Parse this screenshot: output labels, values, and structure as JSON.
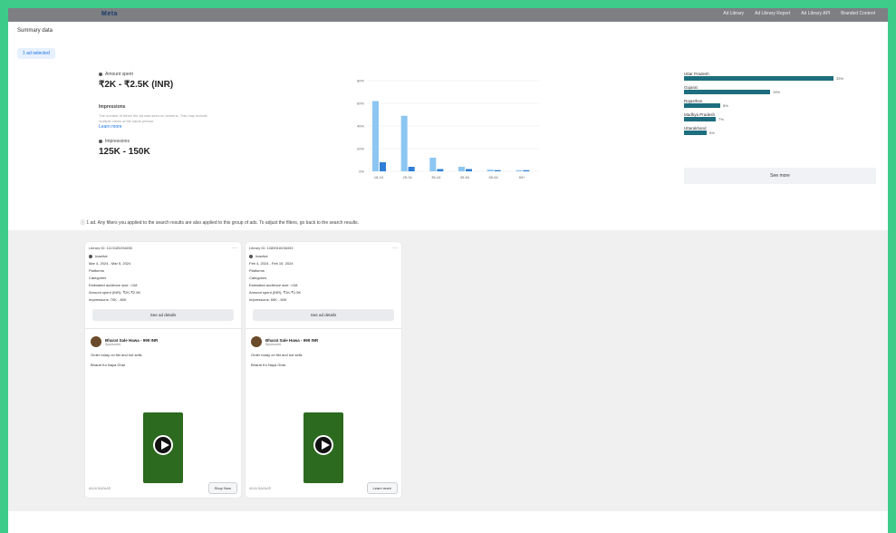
{
  "header": {
    "logo": "Meta",
    "nav": [
      "Ad Library",
      "Ad Library Report",
      "Ad Library API",
      "Branded Content"
    ]
  },
  "page_title": "Summary data",
  "select_button": "1 ad selected",
  "summary": {
    "amount_spent_label": "Amount spent",
    "amount_spent_value": "₹2K - ₹2.5K (INR)",
    "impressions_heading": "Impressions",
    "impressions_desc": "The number of times the ad was seen on screens. This may include multiple views of the same person.",
    "learn_more": "Learn more",
    "impressions_label": "Impressions",
    "impressions_value": "125K - 150K"
  },
  "age_chart": {
    "categories": [
      "18-24",
      "25-34",
      "35-44",
      "45-54",
      "55-64",
      "65+"
    ],
    "series": [
      {
        "values": [
          62,
          49,
          12,
          4,
          1.5,
          1
        ],
        "color": "#8cc6f2"
      },
      {
        "values": [
          8,
          4,
          2,
          2,
          1,
          1
        ],
        "color": "#2f7fd6"
      }
    ],
    "yticks": [
      "0%",
      "20%",
      "40%",
      "60%",
      "80%"
    ],
    "y_max": 80
  },
  "regions": {
    "items": [
      {
        "label": "Uttar Pradesh",
        "pct": "33%",
        "value": 33
      },
      {
        "label": "Gujarat",
        "pct": "19%",
        "value": 19
      },
      {
        "label": "Rajasthan",
        "pct": "8%",
        "value": 8
      },
      {
        "label": "Madhya Pradesh",
        "pct": "7%",
        "value": 7
      },
      {
        "label": "Uttarakhand",
        "pct": "5%",
        "value": 5
      }
    ],
    "see_more": "See more"
  },
  "notice": "ⓘ 1 ad. Any filters you applied to the search results are also applied to this group of ads. To adjust the filters, go back to the search results.",
  "ads": [
    {
      "library_id": "Library ID: 1113185294655",
      "status": "Inactive",
      "dates": "Mar 4, 2024 - Mar 5, 2024",
      "platforms": "Platforms",
      "categories": "Categories",
      "audience": "Estimated audience size: >1M",
      "spend": "Amount spent (INR): ₹2K-₹2.5K",
      "impressions": "Impressions: 70K - 80K",
      "details_btn": "See ad details",
      "brand": "Bharat Sale Hawa - 999 INR",
      "brand_sub": "Sponsored",
      "ad_line1": "Order today on fist and hot sells",
      "ad_line2": "Bharat Ko Naya Ghar",
      "footer_text": "ANJU BAZAAR",
      "cta": "Shop Now"
    },
    {
      "library_id": "Library ID: 1085918438493",
      "status": "Inactive",
      "dates": "Feb 4, 2024 - Feb 15, 2024",
      "platforms": "Platforms",
      "categories": "Categories",
      "audience": "Estimated audience size: >1M",
      "spend": "Amount spent (INR): ₹1K-₹1.5K",
      "impressions": "Impressions: 50K - 60K",
      "details_btn": "See ad details",
      "brand": "Bharat Sale Hawa - 999 INR",
      "brand_sub": "Sponsored",
      "ad_line1": "Order today on fist and hot sells",
      "ad_line2": "Bharat Ko Naya Ghar",
      "footer_text": "ANJU BAZAAR",
      "cta": "Learn more"
    }
  ]
}
